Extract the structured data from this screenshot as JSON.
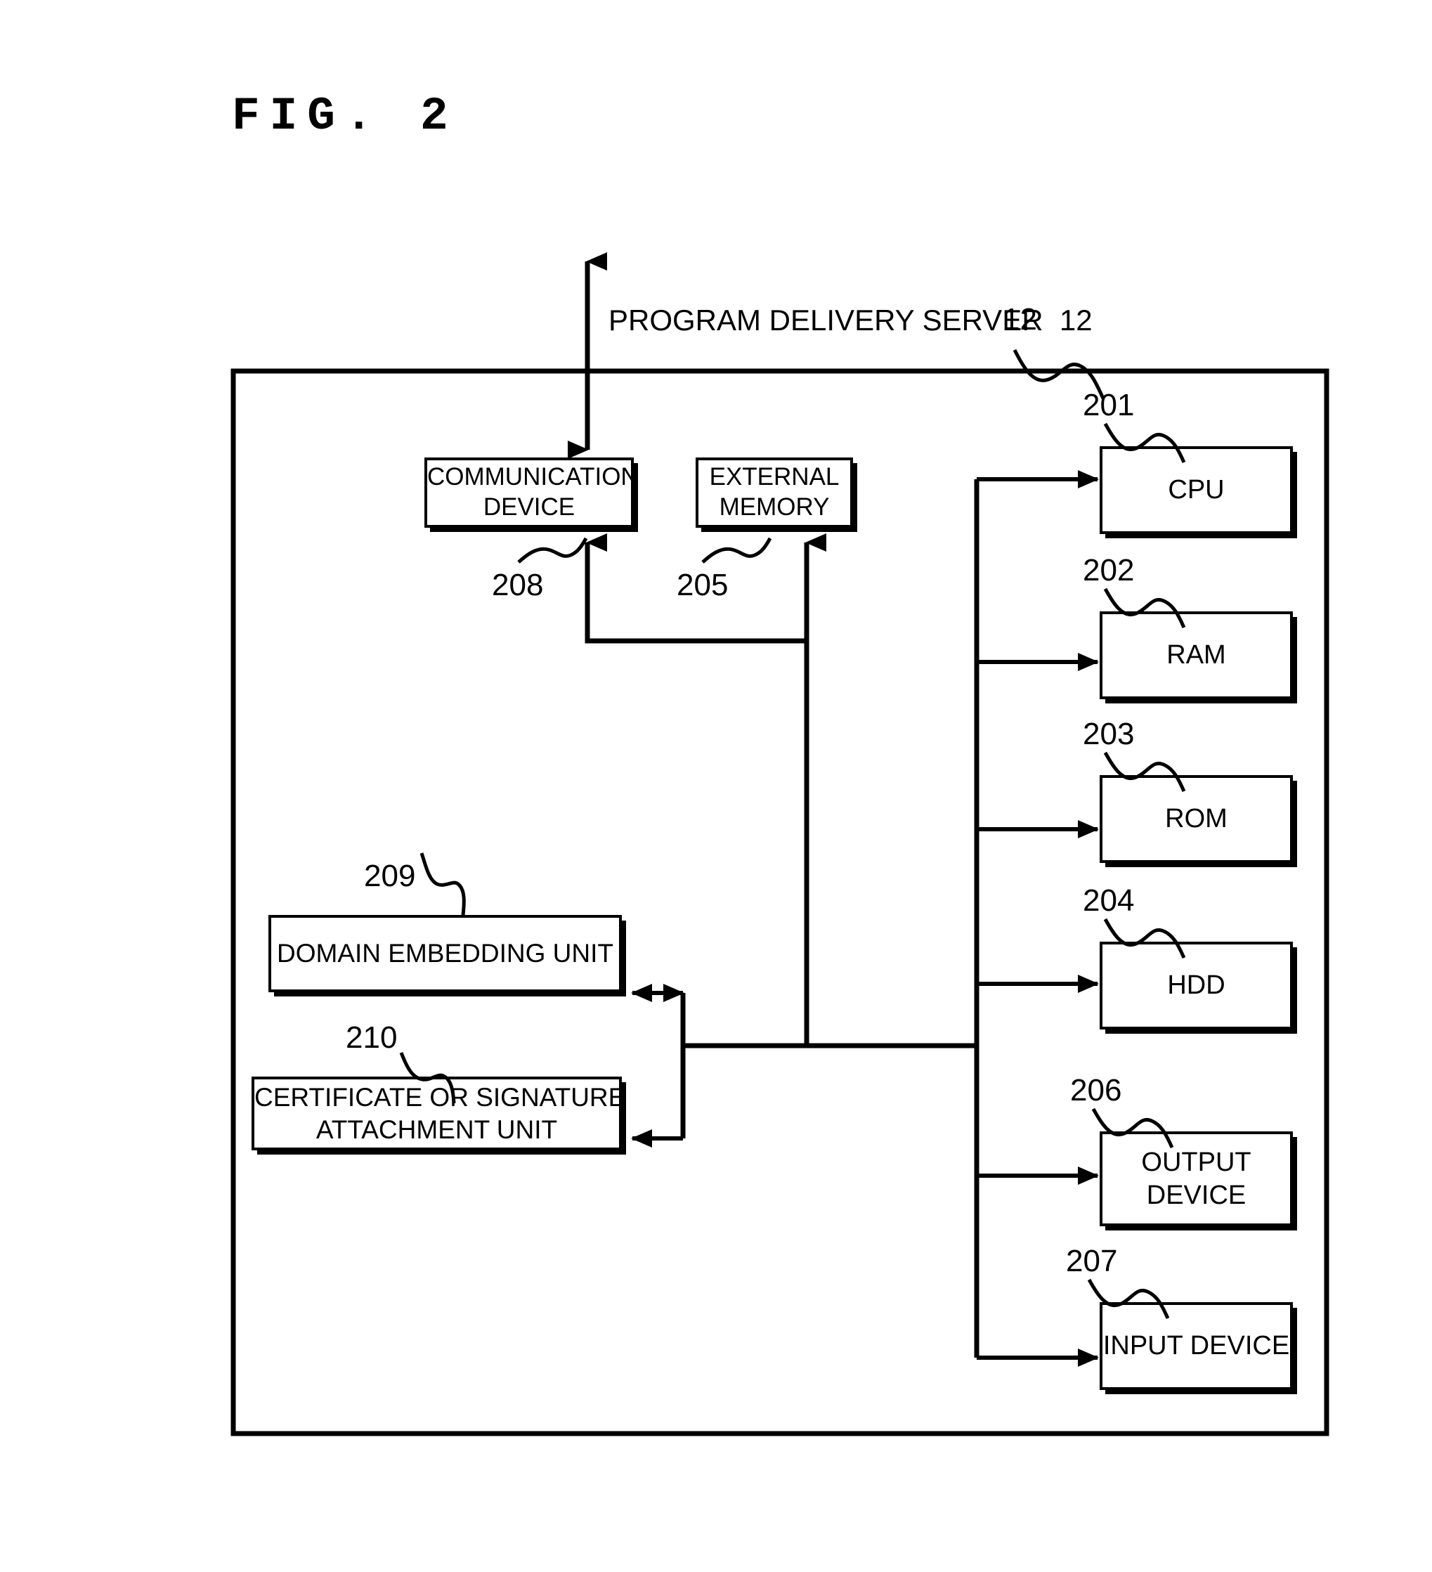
{
  "figure": {
    "title": "FIG. 2",
    "caption": "PROGRAM DELIVERY SERVER  12"
  },
  "diagram": {
    "type": "block-diagram",
    "outer_enclosure": {
      "name": "program-delivery-server",
      "label": "PROGRAM DELIVERY SERVER  12",
      "reference_number": "12"
    },
    "blocks": [
      {
        "id": "comm",
        "label": "COMMUNICATION\nDEVICE",
        "line1": "COMMUNICATION",
        "line2": "DEVICE",
        "reference_number": "208"
      },
      {
        "id": "extmem",
        "label": "EXTERNAL\nMEMORY",
        "line1": "EXTERNAL",
        "line2": "MEMORY",
        "reference_number": "205"
      },
      {
        "id": "cpu",
        "label": "CPU",
        "line1": "CPU",
        "line2": "",
        "reference_number": "201"
      },
      {
        "id": "ram",
        "label": "RAM",
        "line1": "RAM",
        "line2": "",
        "reference_number": "202"
      },
      {
        "id": "rom",
        "label": "ROM",
        "line1": "ROM",
        "line2": "",
        "reference_number": "203"
      },
      {
        "id": "hdd",
        "label": "HDD",
        "line1": "HDD",
        "line2": "",
        "reference_number": "204"
      },
      {
        "id": "output",
        "label": "OUTPUT\nDEVICE",
        "line1": "OUTPUT",
        "line2": "DEVICE",
        "reference_number": "206"
      },
      {
        "id": "input",
        "label": "INPUT DEVICE",
        "line1": "INPUT DEVICE",
        "line2": "",
        "reference_number": "207"
      },
      {
        "id": "domain",
        "label": "DOMAIN EMBEDDING UNIT",
        "line1": "DOMAIN EMBEDDING UNIT",
        "line2": "",
        "reference_number": "209"
      },
      {
        "id": "cert",
        "label": "CERTIFICATE OR SIGNATURE\nATTACHMENT UNIT",
        "line1": "CERTIFICATE OR SIGNATURE",
        "line2": "ATTACHMENT UNIT",
        "reference_number": "210"
      }
    ],
    "connections": [
      {
        "from": "external-network",
        "to": "comm",
        "arrow": "bidirectional"
      },
      {
        "from": "bus",
        "to": "comm",
        "arrow": "single"
      },
      {
        "from": "bus",
        "to": "extmem",
        "arrow": "single"
      },
      {
        "from": "bus",
        "to": "cpu",
        "arrow": "single"
      },
      {
        "from": "bus",
        "to": "ram",
        "arrow": "single"
      },
      {
        "from": "bus",
        "to": "rom",
        "arrow": "single"
      },
      {
        "from": "bus",
        "to": "hdd",
        "arrow": "single"
      },
      {
        "from": "bus",
        "to": "output",
        "arrow": "single"
      },
      {
        "from": "bus",
        "to": "input",
        "arrow": "single"
      },
      {
        "from": "bus",
        "to": "domain",
        "arrow": "single"
      },
      {
        "from": "bus",
        "to": "cert",
        "arrow": "single"
      }
    ],
    "colors": {
      "line": "#000000",
      "background": "#ffffff",
      "text": "#000000"
    }
  },
  "labels": {
    "ref_12": "12",
    "ref_201": "201",
    "ref_202": "202",
    "ref_203": "203",
    "ref_204": "204",
    "ref_205": "205",
    "ref_206": "206",
    "ref_207": "207",
    "ref_208": "208",
    "ref_209": "209",
    "ref_210": "210"
  }
}
